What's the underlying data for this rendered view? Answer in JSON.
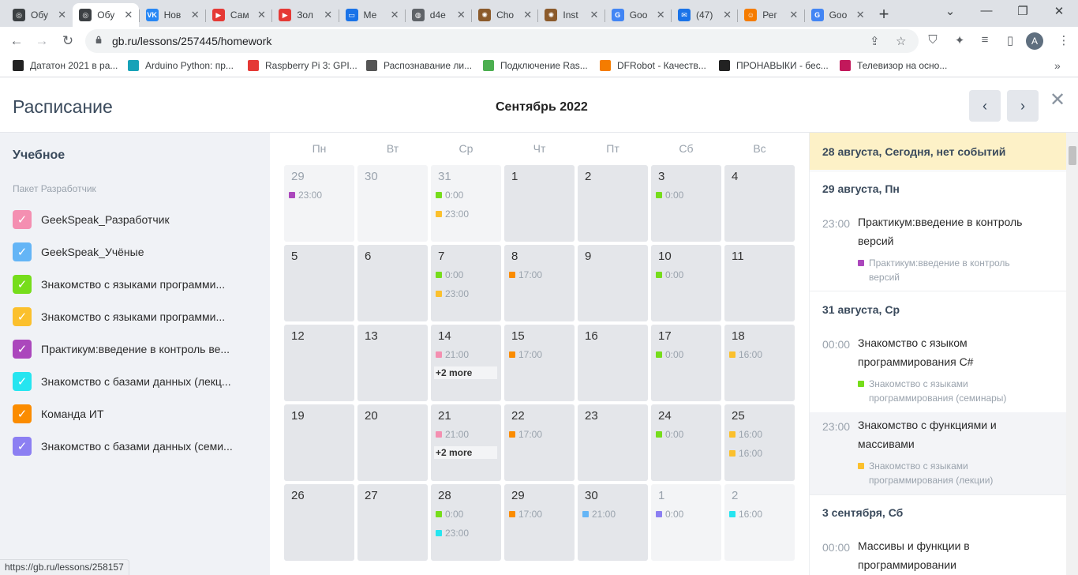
{
  "browser": {
    "tabs": [
      {
        "title": "Обу",
        "icon": "openai",
        "color": "#3c4043"
      },
      {
        "title": "Обу",
        "icon": "openai",
        "color": "#3c4043"
      },
      {
        "title": "Нов",
        "icon": "vk",
        "color": "#2787f5"
      },
      {
        "title": "Сам",
        "icon": "video",
        "color": "#e53935"
      },
      {
        "title": "Зол",
        "icon": "video",
        "color": "#e53935"
      },
      {
        "title": "Ме",
        "icon": "chat",
        "color": "#1a73e8"
      },
      {
        "title": "d4e",
        "icon": "globe",
        "color": "#5f6368"
      },
      {
        "title": "Cho",
        "icon": "gear",
        "color": "#8b5a2b"
      },
      {
        "title": "Inst",
        "icon": "gear",
        "color": "#8b5a2b"
      },
      {
        "title": "Goo",
        "icon": "translate",
        "color": "#4285f4"
      },
      {
        "title": "(47)",
        "icon": "mail",
        "color": "#1a73e8"
      },
      {
        "title": "Рег",
        "icon": "people",
        "color": "#f57c00"
      },
      {
        "title": "Goo",
        "icon": "translate",
        "color": "#4285f4"
      }
    ],
    "url": "gb.ru/lessons/257445/homework",
    "profile_initial": "A",
    "bookmarks": [
      {
        "label": "Дататон 2021 в ра...",
        "color": "#222"
      },
      {
        "label": "Arduino Python: пр...",
        "color": "#17a2b8"
      },
      {
        "label": "Raspberry Pi 3: GPI...",
        "color": "#e53935"
      },
      {
        "label": "Распознавание ли...",
        "color": "#555"
      },
      {
        "label": "Подключение Ras...",
        "color": "#4caf50"
      },
      {
        "label": "DFRobot - Качеств...",
        "color": "#f57c00"
      },
      {
        "label": "ПРОНАВЫКИ - бес...",
        "color": "#222"
      },
      {
        "label": "Телевизор на осно...",
        "color": "#c2185b"
      }
    ],
    "status_url": "https://gb.ru/lessons/258157"
  },
  "app": {
    "title": "Расписание",
    "month": "Сентябрь 2022",
    "prev_icon": "‹",
    "next_icon": "›",
    "close_icon": "✕"
  },
  "sidebar": {
    "heading": "Учебное",
    "group": "Пакет Разработчик",
    "calendars": [
      {
        "label": "GeekSpeak_Разработчик",
        "color": "#f48fb1",
        "checked": true
      },
      {
        "label": "GeekSpeak_Учёные",
        "color": "#64b5f6",
        "checked": true
      },
      {
        "label": "Знакомство с языками программи...",
        "color": "#76dd1b",
        "checked": true
      },
      {
        "label": "Знакомство с языками программи...",
        "color": "#fbc02d",
        "checked": true
      },
      {
        "label": "Практикум:введение в контроль ве...",
        "color": "#ab47bc",
        "checked": true
      },
      {
        "label": "Знакомство с базами данных (лекц...",
        "color": "#26e5f0",
        "checked": true
      },
      {
        "label": "Команда ИТ",
        "color": "#fb8c00",
        "checked": true
      },
      {
        "label": "Знакомство с базами данных (семи...",
        "color": "#8c7ff2",
        "checked": true
      }
    ]
  },
  "calendar": {
    "weekdays": [
      "Пн",
      "Вт",
      "Ср",
      "Чт",
      "Пт",
      "Сб",
      "Вс"
    ],
    "weeks": [
      [
        {
          "day": "29",
          "other": true,
          "events": [
            {
              "time": "23:00",
              "color": "#ab47bc"
            }
          ]
        },
        {
          "day": "30",
          "other": true,
          "events": []
        },
        {
          "day": "31",
          "other": true,
          "events": [
            {
              "time": "0:00",
              "color": "#76dd1b"
            },
            {
              "time": "23:00",
              "color": "#fbc02d"
            }
          ]
        },
        {
          "day": "1",
          "other": false,
          "events": []
        },
        {
          "day": "2",
          "other": false,
          "events": []
        },
        {
          "day": "3",
          "other": false,
          "events": [
            {
              "time": "0:00",
              "color": "#76dd1b"
            }
          ]
        },
        {
          "day": "4",
          "other": false,
          "events": []
        }
      ],
      [
        {
          "day": "5",
          "other": false,
          "events": []
        },
        {
          "day": "6",
          "other": false,
          "events": []
        },
        {
          "day": "7",
          "other": false,
          "events": [
            {
              "time": "0:00",
              "color": "#76dd1b"
            },
            {
              "time": "23:00",
              "color": "#fbc02d"
            }
          ]
        },
        {
          "day": "8",
          "other": false,
          "events": [
            {
              "time": "17:00",
              "color": "#fb8c00"
            }
          ]
        },
        {
          "day": "9",
          "other": false,
          "events": []
        },
        {
          "day": "10",
          "other": false,
          "events": [
            {
              "time": "0:00",
              "color": "#76dd1b"
            }
          ]
        },
        {
          "day": "11",
          "other": false,
          "events": []
        }
      ],
      [
        {
          "day": "12",
          "other": false,
          "events": []
        },
        {
          "day": "13",
          "other": false,
          "events": []
        },
        {
          "day": "14",
          "other": false,
          "events": [
            {
              "time": "21:00",
              "color": "#f48fb1"
            }
          ],
          "more": "+2 more"
        },
        {
          "day": "15",
          "other": false,
          "events": [
            {
              "time": "17:00",
              "color": "#fb8c00"
            }
          ]
        },
        {
          "day": "16",
          "other": false,
          "events": []
        },
        {
          "day": "17",
          "other": false,
          "events": [
            {
              "time": "0:00",
              "color": "#76dd1b"
            }
          ]
        },
        {
          "day": "18",
          "other": false,
          "events": [
            {
              "time": "16:00",
              "color": "#fbc02d"
            }
          ]
        }
      ],
      [
        {
          "day": "19",
          "other": false,
          "events": []
        },
        {
          "day": "20",
          "other": false,
          "events": []
        },
        {
          "day": "21",
          "other": false,
          "events": [
            {
              "time": "21:00",
              "color": "#f48fb1"
            }
          ],
          "more": "+2 more"
        },
        {
          "day": "22",
          "other": false,
          "events": [
            {
              "time": "17:00",
              "color": "#fb8c00"
            }
          ]
        },
        {
          "day": "23",
          "other": false,
          "events": []
        },
        {
          "day": "24",
          "other": false,
          "events": [
            {
              "time": "0:00",
              "color": "#76dd1b"
            }
          ]
        },
        {
          "day": "25",
          "other": false,
          "events": [
            {
              "time": "16:00",
              "color": "#fbc02d"
            },
            {
              "time": "16:00",
              "color": "#fbc02d"
            }
          ]
        }
      ],
      [
        {
          "day": "26",
          "other": false,
          "events": []
        },
        {
          "day": "27",
          "other": false,
          "events": []
        },
        {
          "day": "28",
          "other": false,
          "events": [
            {
              "time": "0:00",
              "color": "#76dd1b"
            },
            {
              "time": "23:00",
              "color": "#26e5f0"
            }
          ]
        },
        {
          "day": "29",
          "other": false,
          "events": [
            {
              "time": "17:00",
              "color": "#fb8c00"
            }
          ]
        },
        {
          "day": "30",
          "other": false,
          "events": [
            {
              "time": "21:00",
              "color": "#64b5f6"
            }
          ]
        },
        {
          "day": "1",
          "other": true,
          "events": [
            {
              "time": "0:00",
              "color": "#8c7ff2"
            }
          ]
        },
        {
          "day": "2",
          "other": true,
          "events": [
            {
              "time": "16:00",
              "color": "#26e5f0"
            }
          ]
        }
      ]
    ]
  },
  "agenda": {
    "today": "28 августа, Сегодня, нет событий",
    "days": [
      {
        "label": "29 августа, Пн"
      },
      {
        "label": "31 августа, Ср"
      },
      {
        "label": "3 сентября, Сб"
      }
    ],
    "events": [
      {
        "time": "23:00",
        "title": "Практикум:введение в контроль версий",
        "calendar": "Практикум:введение в контроль версий",
        "color": "#ab47bc"
      },
      {
        "time": "00:00",
        "title": "Знакомство с языком программирования C#",
        "calendar": "Знакомство с языками программирования (семинары)",
        "color": "#76dd1b"
      },
      {
        "time": "23:00",
        "title": "Знакомство с функциями и массивами",
        "calendar": "Знакомство с языками программирования (лекции)",
        "color": "#fbc02d"
      },
      {
        "time": "00:00",
        "title": "Массивы и функции в программировании",
        "calendar": "",
        "color": "#76dd1b"
      }
    ]
  }
}
